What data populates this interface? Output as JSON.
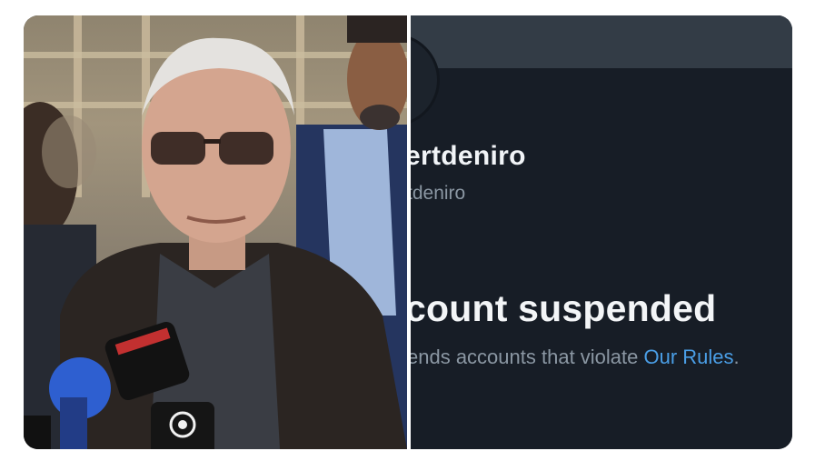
{
  "profile": {
    "display_name": "ertdeniro",
    "handle": "tdeniro",
    "status_headline": "count suspended",
    "status_description": "ends accounts that violate ",
    "rules_link": "Our Rules",
    "description_end": ".",
    "link_color": "#4a9ee6"
  },
  "photo": {
    "microphone_logo": "CBS-eye-logo"
  }
}
